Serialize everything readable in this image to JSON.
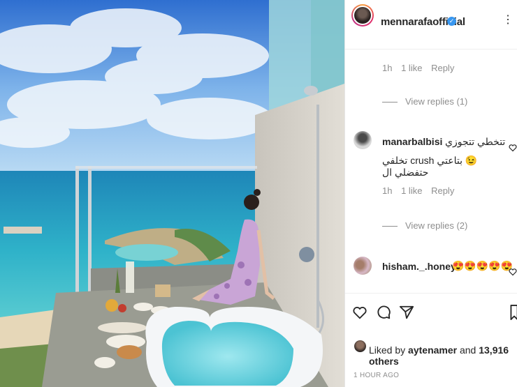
{
  "post": {
    "username": "mennarafaofficial",
    "verified_icon": "verified-badge-icon",
    "more_icon": "more-options-icon"
  },
  "comments": [
    {
      "meta": {
        "age": "1h",
        "likes": "1 like",
        "reply": "Reply"
      },
      "view_replies": "View replies (1)"
    },
    {
      "username": "manarbalbisi",
      "text_line1": "تتخطي تتجوزي",
      "text_line2": "😉 بتاعتي crush تخلفي حتفضلي ال",
      "meta": {
        "age": "1h",
        "likes": "1 like",
        "reply": "Reply"
      },
      "view_replies": "View replies (2)"
    },
    {
      "username": "hisham._.honey",
      "text": "😍😍😍😍😍"
    }
  ],
  "likes": {
    "prefix": "Liked by ",
    "user": "aytenamer",
    "middle": " and ",
    "count": "13,916 others"
  },
  "timestamp": "1 HOUR AGO",
  "colors": {
    "verified": "#3897f0",
    "meta_grey": "#8e8e8e",
    "text": "#262626"
  }
}
